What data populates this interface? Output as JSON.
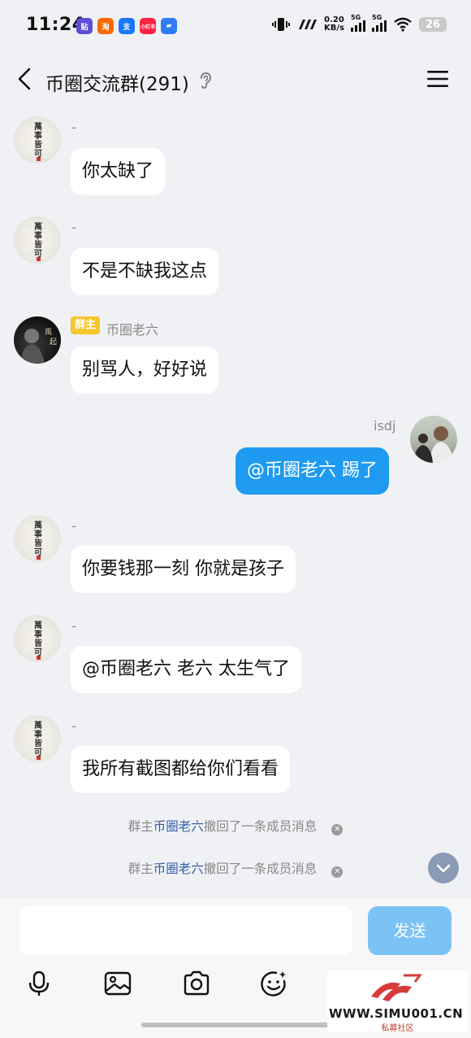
{
  "status_bar": {
    "time": "11:24",
    "app_icons": [
      {
        "label": "贴",
        "color": "#5b4fd6"
      },
      {
        "label": "淘",
        "color": "#ff6a00"
      },
      {
        "label": "支",
        "color": "#1677ff"
      },
      {
        "label": "小红书",
        "color": "#ff2442"
      },
      {
        "label": "▰",
        "color": "#2f7cf6"
      }
    ],
    "net_speed": "0.20",
    "net_unit": "KB/s",
    "sig1_tag": "5G",
    "sig2_tag": "5G",
    "battery": "26"
  },
  "header": {
    "title": "币圈交流群(291)"
  },
  "messages": [
    {
      "sender": "-",
      "text": "你太缺了"
    },
    {
      "sender": "-",
      "text": "不是不缺我这点"
    },
    {
      "badge": "群主",
      "sender": "币圈老六",
      "text": "别骂人，好好说"
    },
    {
      "sender": "isdj",
      "text": "@币圈老六 踢了"
    },
    {
      "sender": "-",
      "text": "你要钱那一刻 你就是孩子"
    },
    {
      "sender": "-",
      "text": "@币圈老六 老六 太生气了"
    },
    {
      "sender": "-",
      "text": "我所有截图都给你们看看"
    }
  ],
  "system_notes": [
    {
      "prefix": "群主",
      "name": "币圈老六",
      "suffix": "撤回了一条成员消息"
    },
    {
      "prefix": "群主",
      "name": "币圈老六",
      "suffix": "撤回了一条成员消息"
    }
  ],
  "input": {
    "value": "",
    "send_label": "发送"
  },
  "watermark": {
    "url": "WWW.SIMU001.CN",
    "sub": "私募社区"
  },
  "colors": {
    "accent": "#1e9bf0",
    "owner_badge": "#f8c52a",
    "highlight_name": "#2f5ea8",
    "send_disabled": "#7bc3f5"
  }
}
